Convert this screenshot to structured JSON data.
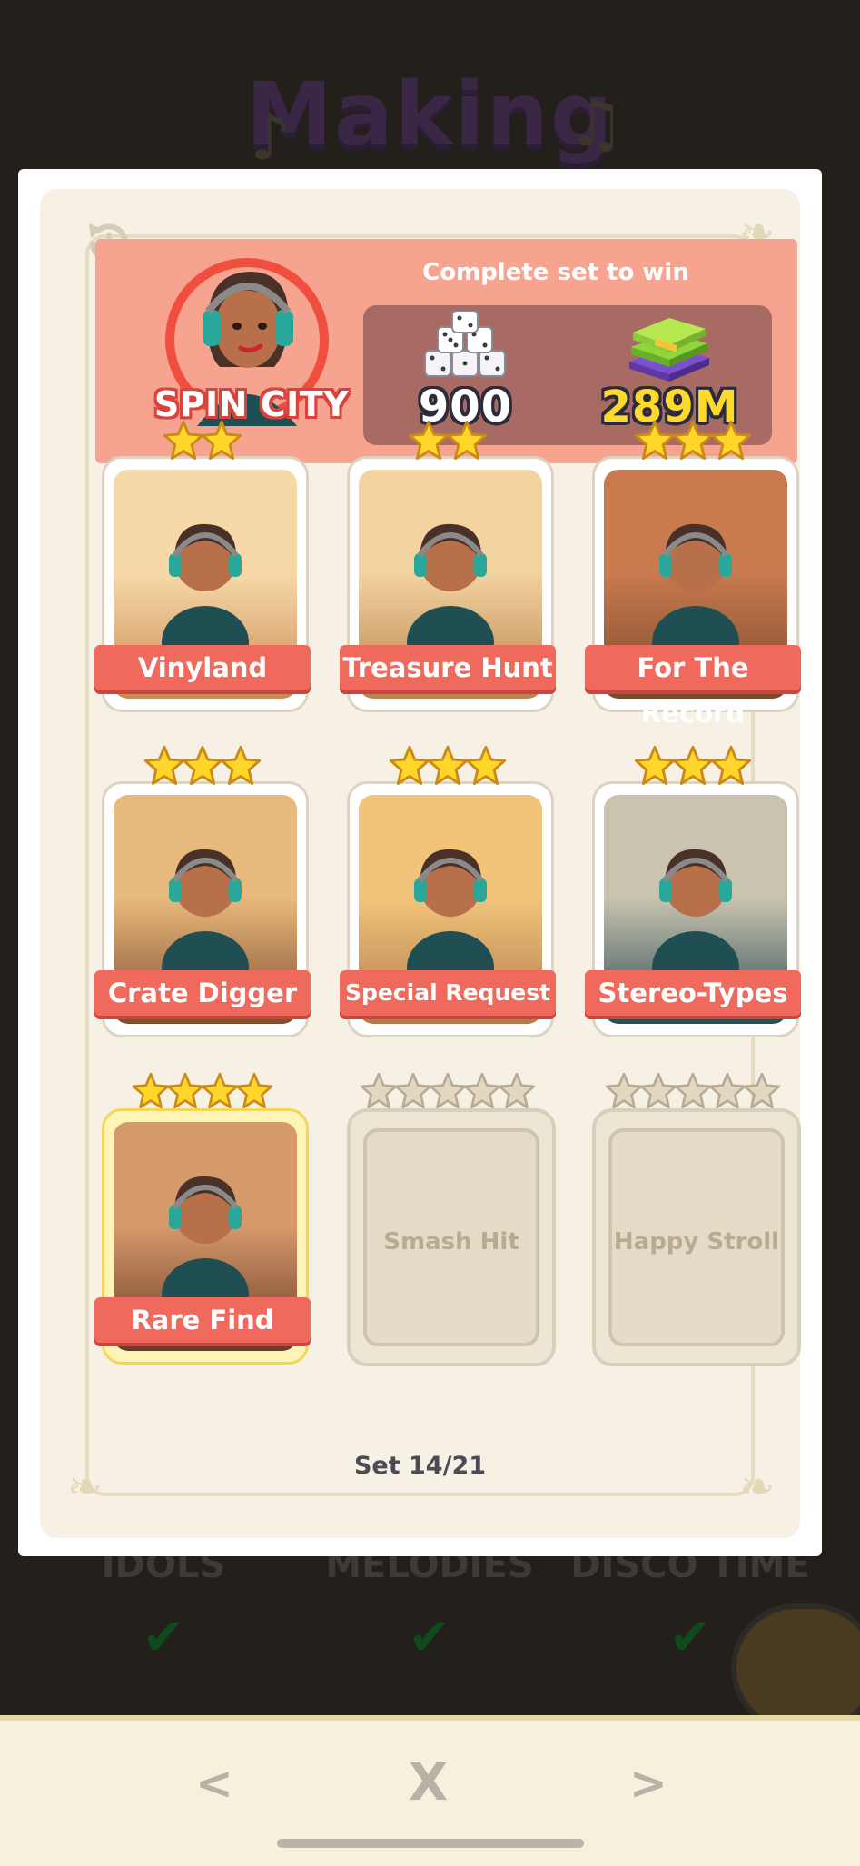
{
  "background": {
    "title": "Making",
    "labels": [
      "IDOLS",
      "MELODIES",
      "DISCO TIME"
    ]
  },
  "header": {
    "title": "Complete set to win",
    "set_name": "SPIN CITY",
    "rewards": {
      "dice": "900",
      "cash": "289M"
    }
  },
  "cards": [
    {
      "name": "Vinyland",
      "stars": 2,
      "collected": true,
      "gold": false
    },
    {
      "name": "Treasure Hunt",
      "stars": 2,
      "collected": true,
      "gold": false
    },
    {
      "name": "For The Record",
      "stars": 3,
      "collected": true,
      "gold": false
    },
    {
      "name": "Crate Digger",
      "stars": 3,
      "collected": true,
      "gold": false
    },
    {
      "name": "Special Request",
      "stars": 3,
      "collected": true,
      "gold": false
    },
    {
      "name": "Stereo-Types",
      "stars": 3,
      "collected": true,
      "gold": false
    },
    {
      "name": "Rare Find",
      "stars": 4,
      "collected": true,
      "gold": true
    },
    {
      "name": "Smash Hit",
      "stars": 5,
      "collected": false,
      "gold": false
    },
    {
      "name": "Happy Stroll",
      "stars": 5,
      "collected": false,
      "gold": false
    }
  ],
  "set_progress": "Set 14/21",
  "nav": {
    "prev": "<",
    "close": "X",
    "next": ">"
  }
}
